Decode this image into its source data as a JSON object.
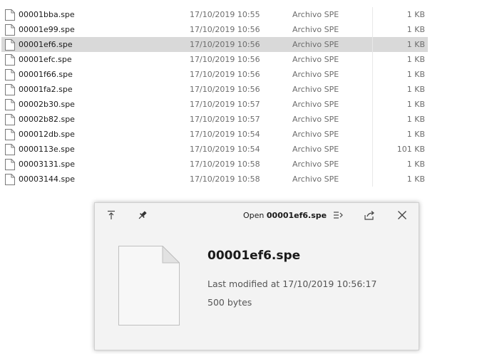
{
  "files": [
    {
      "name": "00001bba.spe",
      "modified": "17/10/2019 10:55",
      "type": "Archivo SPE",
      "size": "1 KB",
      "selected": false
    },
    {
      "name": "00001e99.spe",
      "modified": "17/10/2019 10:56",
      "type": "Archivo SPE",
      "size": "1 KB",
      "selected": false
    },
    {
      "name": "00001ef6.spe",
      "modified": "17/10/2019 10:56",
      "type": "Archivo SPE",
      "size": "1 KB",
      "selected": true
    },
    {
      "name": "00001efc.spe",
      "modified": "17/10/2019 10:56",
      "type": "Archivo SPE",
      "size": "1 KB",
      "selected": false
    },
    {
      "name": "00001f66.spe",
      "modified": "17/10/2019 10:56",
      "type": "Archivo SPE",
      "size": "1 KB",
      "selected": false
    },
    {
      "name": "00001fa2.spe",
      "modified": "17/10/2019 10:56",
      "type": "Archivo SPE",
      "size": "1 KB",
      "selected": false
    },
    {
      "name": "00002b30.spe",
      "modified": "17/10/2019 10:57",
      "type": "Archivo SPE",
      "size": "1 KB",
      "selected": false
    },
    {
      "name": "00002b82.spe",
      "modified": "17/10/2019 10:57",
      "type": "Archivo SPE",
      "size": "1 KB",
      "selected": false
    },
    {
      "name": "000012db.spe",
      "modified": "17/10/2019 10:54",
      "type": "Archivo SPE",
      "size": "1 KB",
      "selected": false
    },
    {
      "name": "0000113e.spe",
      "modified": "17/10/2019 10:54",
      "type": "Archivo SPE",
      "size": "101 KB",
      "selected": false
    },
    {
      "name": "00003131.spe",
      "modified": "17/10/2019 10:58",
      "type": "Archivo SPE",
      "size": "1 KB",
      "selected": false
    },
    {
      "name": "00003144.spe",
      "modified": "17/10/2019 10:58",
      "type": "Archivo SPE",
      "size": "1 KB",
      "selected": false
    }
  ],
  "flyout": {
    "open_prefix": "Open",
    "open_filename": "00001ef6.spe",
    "title": "00001ef6.spe",
    "modified": "Last modified at 17/10/2019 10:56:17",
    "size": "500 bytes",
    "icons": {
      "move_top": "move-to-top-icon",
      "pin": "pin-icon",
      "open_with": "open-with-icon",
      "share": "share-icon",
      "close": "close-icon"
    }
  },
  "colors": {
    "selected_row": "#d9d9d9",
    "secondary_text": "#6d6d6d",
    "flyout_bg": "#f3f3f3"
  }
}
